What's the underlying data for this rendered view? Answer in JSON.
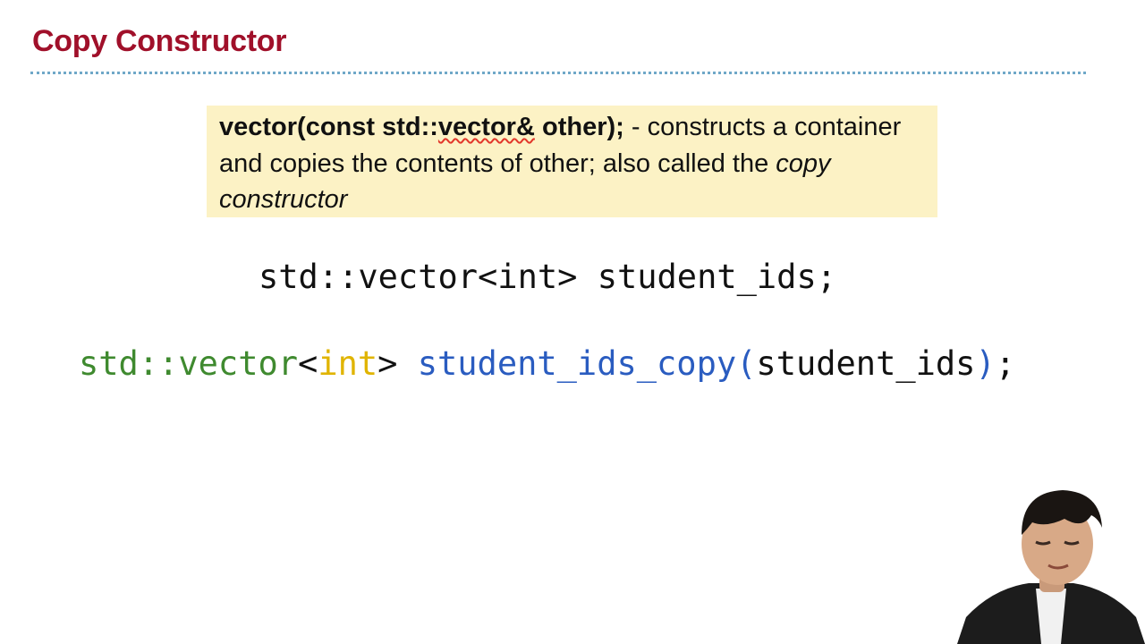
{
  "slide": {
    "title": "Copy Constructor",
    "definition": {
      "sig_prefix": "vector(const std::",
      "sig_squiggle": "vector&",
      "sig_suffix": " other);",
      "desc_1": " - constructs a container and copies the contents of other; also called the ",
      "desc_em": "copy constructor"
    },
    "code_line_1": "std::vector<int> student_ids;",
    "code_line_2": {
      "type_prefix": "std::vector",
      "lt": "<",
      "kw": "int",
      "gt_space": "> ",
      "var_name": "student_ids_copy",
      "paren_open": "(",
      "arg": "student_ids",
      "paren_close": ")",
      "semi": ";"
    }
  },
  "colors": {
    "title": "#a0102a",
    "box_bg": "#fcf2c5",
    "type": "#3f8a2f",
    "keyword": "#e0b400",
    "identifier": "#2a5cc0",
    "rule": "#6fa8c8"
  }
}
